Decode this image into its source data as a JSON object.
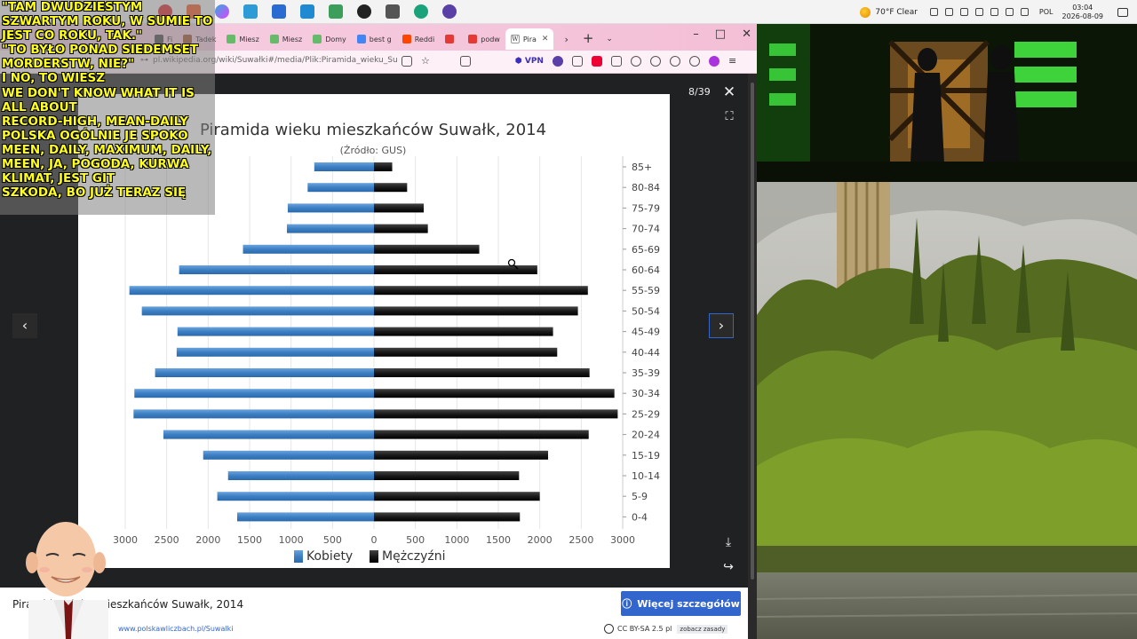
{
  "taskbar": {
    "weather": "70°F  Clear",
    "language": "POL",
    "time": "03:04",
    "date": "2026-08-09"
  },
  "browser": {
    "tabs": [
      {
        "label": "Fi",
        "color": "#4a4a4a"
      },
      {
        "label": "Tadek",
        "color": "#a0522d"
      },
      {
        "label": "Miesz",
        "color": "#66bb6a"
      },
      {
        "label": "Miesz",
        "color": "#66bb6a"
      },
      {
        "label": "Domy",
        "color": "#66bb6a"
      },
      {
        "label": "best g",
        "color": "#4285f4"
      },
      {
        "label": "Reddi",
        "color": "#ff4500"
      },
      {
        "label": "",
        "color": "#e53935"
      },
      {
        "label": "podw",
        "color": "#e53935"
      }
    ],
    "active_tab": {
      "label": "Pira",
      "icon": "W"
    },
    "url": "pl.wikipedia.org/wiki/Suwałki#/media/Plik:Piramida_wieku_Suwałk",
    "vpn_label": "VPN"
  },
  "viewer": {
    "counter": "8/39",
    "caption": "Piramida wieku mieszkańców Suwałk, 2014",
    "more_button": "Więcej szczegółów",
    "source": "www.polskawliczbach.pl/Suwalki",
    "license": "CC BY-SA 2.5 pl",
    "license_link": "zobacz zasady"
  },
  "chart_data": {
    "type": "bar",
    "orientation": "horizontal",
    "title": "Piramida wieku mieszkańców Suwałk, 2014",
    "subtitle": "(Źródło: GUS)",
    "categories": [
      "85+",
      "80-84",
      "75-79",
      "70-74",
      "65-69",
      "60-64",
      "55-59",
      "50-54",
      "45-49",
      "40-44",
      "35-39",
      "30-34",
      "25-29",
      "20-24",
      "15-19",
      "10-14",
      "5-9",
      "0-4"
    ],
    "series": [
      {
        "name": "Kobiety",
        "color": "#3d7fc4",
        "values": [
          720,
          800,
          1040,
          1050,
          1580,
          2350,
          2950,
          2800,
          2370,
          2380,
          2640,
          2890,
          2900,
          2540,
          2060,
          1760,
          1890,
          1650
        ]
      },
      {
        "name": "Mężczyźni",
        "color": "#1a1a1a",
        "values": [
          220,
          400,
          600,
          650,
          1270,
          1970,
          2580,
          2460,
          2160,
          2210,
          2600,
          2900,
          2940,
          2590,
          2100,
          1750,
          2000,
          1760
        ]
      }
    ],
    "x_ticks": [
      "3000",
      "2500",
      "2000",
      "1500",
      "1000",
      "500",
      "0",
      "500",
      "1000",
      "1500",
      "2000",
      "2500",
      "3000"
    ],
    "xlim": [
      -3000,
      3000
    ],
    "grid": true,
    "legend_position": "bottom"
  },
  "overlay": {
    "lyrics": [
      "\"TAM DWUDZIESTYM",
      "SZWARTYM ROKU, W SUMIE TO",
      "JEST CO ROKU, TAK.\"",
      " \"TO BYŁO PONAD SIEDEMSET",
      "MORDERSTW, NIE?\"",
      "I NO, TO WIESZ",
      " WE DON'T KNOW WHAT IT IS",
      "ALL ABOUT",
      " RECORD-HIGH, MEAN-DAILY",
      "POLSKA OGÓLNIE JE SPOKO",
      " MEEN, DAILY, MAXIMUM, DAILY,",
      "MEEN, JA, POGODA, KURWA",
      "KLIMAT, JEST GIT",
      " SZKODA, BO JUŻ TERAZ SIĘ"
    ]
  }
}
